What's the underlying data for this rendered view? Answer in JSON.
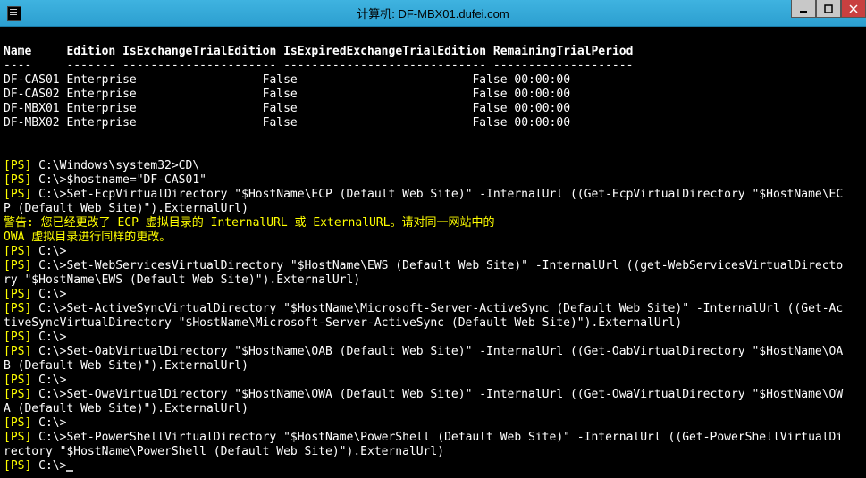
{
  "window": {
    "title": "计算机: DF-MBX01.dufei.com"
  },
  "table": {
    "headers": [
      "Name",
      "Edition",
      "IsExchangeTrialEdition",
      "IsExpiredExchangeTrialEdition",
      "RemainingTrialPeriod"
    ],
    "divider": "----",
    "rows": [
      {
        "name": "DF-CAS01",
        "edition": "Enterprise",
        "isTrial": "False",
        "isExpired": "False",
        "remaining": "00:00:00"
      },
      {
        "name": "DF-CAS02",
        "edition": "Enterprise",
        "isTrial": "False",
        "isExpired": "False",
        "remaining": "00:00:00"
      },
      {
        "name": "DF-MBX01",
        "edition": "Enterprise",
        "isTrial": "False",
        "isExpired": "False",
        "remaining": "00:00:00"
      },
      {
        "name": "DF-MBX02",
        "edition": "Enterprise",
        "isTrial": "False",
        "isExpired": "False",
        "remaining": "00:00:00"
      }
    ]
  },
  "lines": {
    "ps": "[PS]",
    "cd": "C:\\Windows\\system32>CD\\",
    "hostname": "C:\\>$hostname=\"DF-CAS01\"",
    "ecp1": "C:\\>Set-EcpVirtualDirectory \"$HostName\\ECP (Default Web Site)\" -InternalUrl ((Get-EcpVirtualDirectory \"$HostName\\EC",
    "ecp2": "P (Default Web Site)\").ExternalUrl)",
    "warn1": "警告: 您已经更改了 ECP 虚拟目录的 InternalURL 或 ExternalURL。请对同一网站中的",
    "warn2": "OWA 虚拟目录进行同样的更改。",
    "blank": "C:\\>",
    "ews1": "C:\\>Set-WebServicesVirtualDirectory \"$HostName\\EWS (Default Web Site)\" -InternalUrl ((get-WebServicesVirtualDirecto",
    "ews2": "ry \"$HostName\\EWS (Default Web Site)\").ExternalUrl)",
    "as1": "C:\\>Set-ActiveSyncVirtualDirectory \"$HostName\\Microsoft-Server-ActiveSync (Default Web Site)\" -InternalUrl ((Get-Ac",
    "as2": "tiveSyncVirtualDirectory \"$HostName\\Microsoft-Server-ActiveSync (Default Web Site)\").ExternalUrl)",
    "oab1": "C:\\>Set-OabVirtualDirectory \"$HostName\\OAB (Default Web Site)\" -InternalUrl ((Get-OabVirtualDirectory \"$HostName\\OA",
    "oab2": "B (Default Web Site)\").ExternalUrl)",
    "owa1": "C:\\>Set-OwaVirtualDirectory \"$HostName\\OWA (Default Web Site)\" -InternalUrl ((Get-OwaVirtualDirectory \"$HostName\\OW",
    "owa2": "A (Default Web Site)\").ExternalUrl)",
    "psd1": "C:\\>Set-PowerShellVirtualDirectory \"$HostName\\PowerShell (Default Web Site)\" -InternalUrl ((Get-PowerShellVirtualDi",
    "psd2": "rectory \"$HostName\\PowerShell (Default Web Site)\").ExternalUrl)",
    "final": "C:\\>"
  }
}
